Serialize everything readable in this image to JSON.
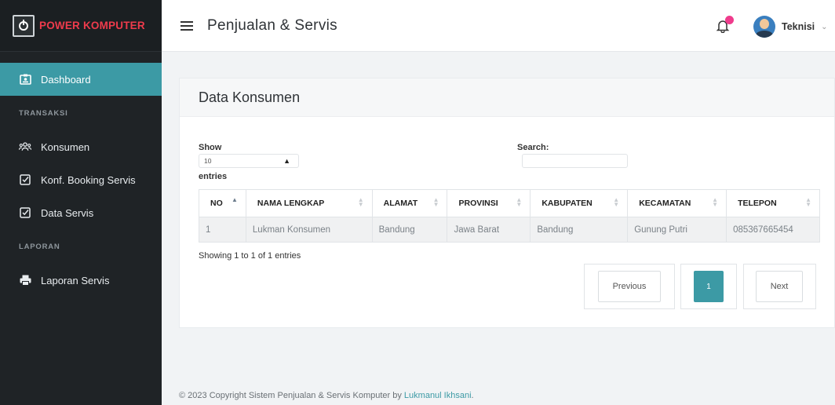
{
  "brand": {
    "name": "POWER KOMPUTER"
  },
  "sidebar": {
    "items": [
      {
        "type": "item",
        "label": "Dashboard",
        "icon": "id-card-icon",
        "active": true
      },
      {
        "type": "heading",
        "label": "TRANSAKSI"
      },
      {
        "type": "item",
        "label": "Konsumen",
        "icon": "users-icon"
      },
      {
        "type": "item",
        "label": "Konf. Booking Servis",
        "icon": "check-square-icon"
      },
      {
        "type": "item",
        "label": "Data Servis",
        "icon": "check-square-icon"
      },
      {
        "type": "heading",
        "label": "LAPORAN"
      },
      {
        "type": "item",
        "label": "Laporan Servis",
        "icon": "printer-icon"
      }
    ]
  },
  "header": {
    "title": "Penjualan & Servis",
    "user": "Teknisi",
    "notification_icon": "bell-icon",
    "accent": "#3c9aa5",
    "badge_color": "#ef3b8c"
  },
  "card": {
    "title": "Data Konsumen",
    "show_label": "Show",
    "entries_label": "entries",
    "page_length": "10",
    "search_label": "Search:",
    "columns": [
      "NO",
      "NAMA LENGKAP",
      "ALAMAT",
      "PROVINSI",
      "KABUPATEN",
      "KECAMATAN",
      "TELEPON"
    ],
    "rows": [
      [
        "1",
        "Lukman Konsumen",
        "Bandung",
        "Jawa Barat",
        "Bandung",
        "Gunung Putri",
        "085367665454"
      ]
    ],
    "info": "Showing 1 to 1 of 1 entries",
    "pagination": {
      "previous": "Previous",
      "current": "1",
      "next": "Next"
    }
  },
  "footer": {
    "text": "© 2023 Copyright Sistem Penjualan & Servis Komputer by ",
    "author": "Lukmanul Ikhsani",
    "suffix": "."
  }
}
